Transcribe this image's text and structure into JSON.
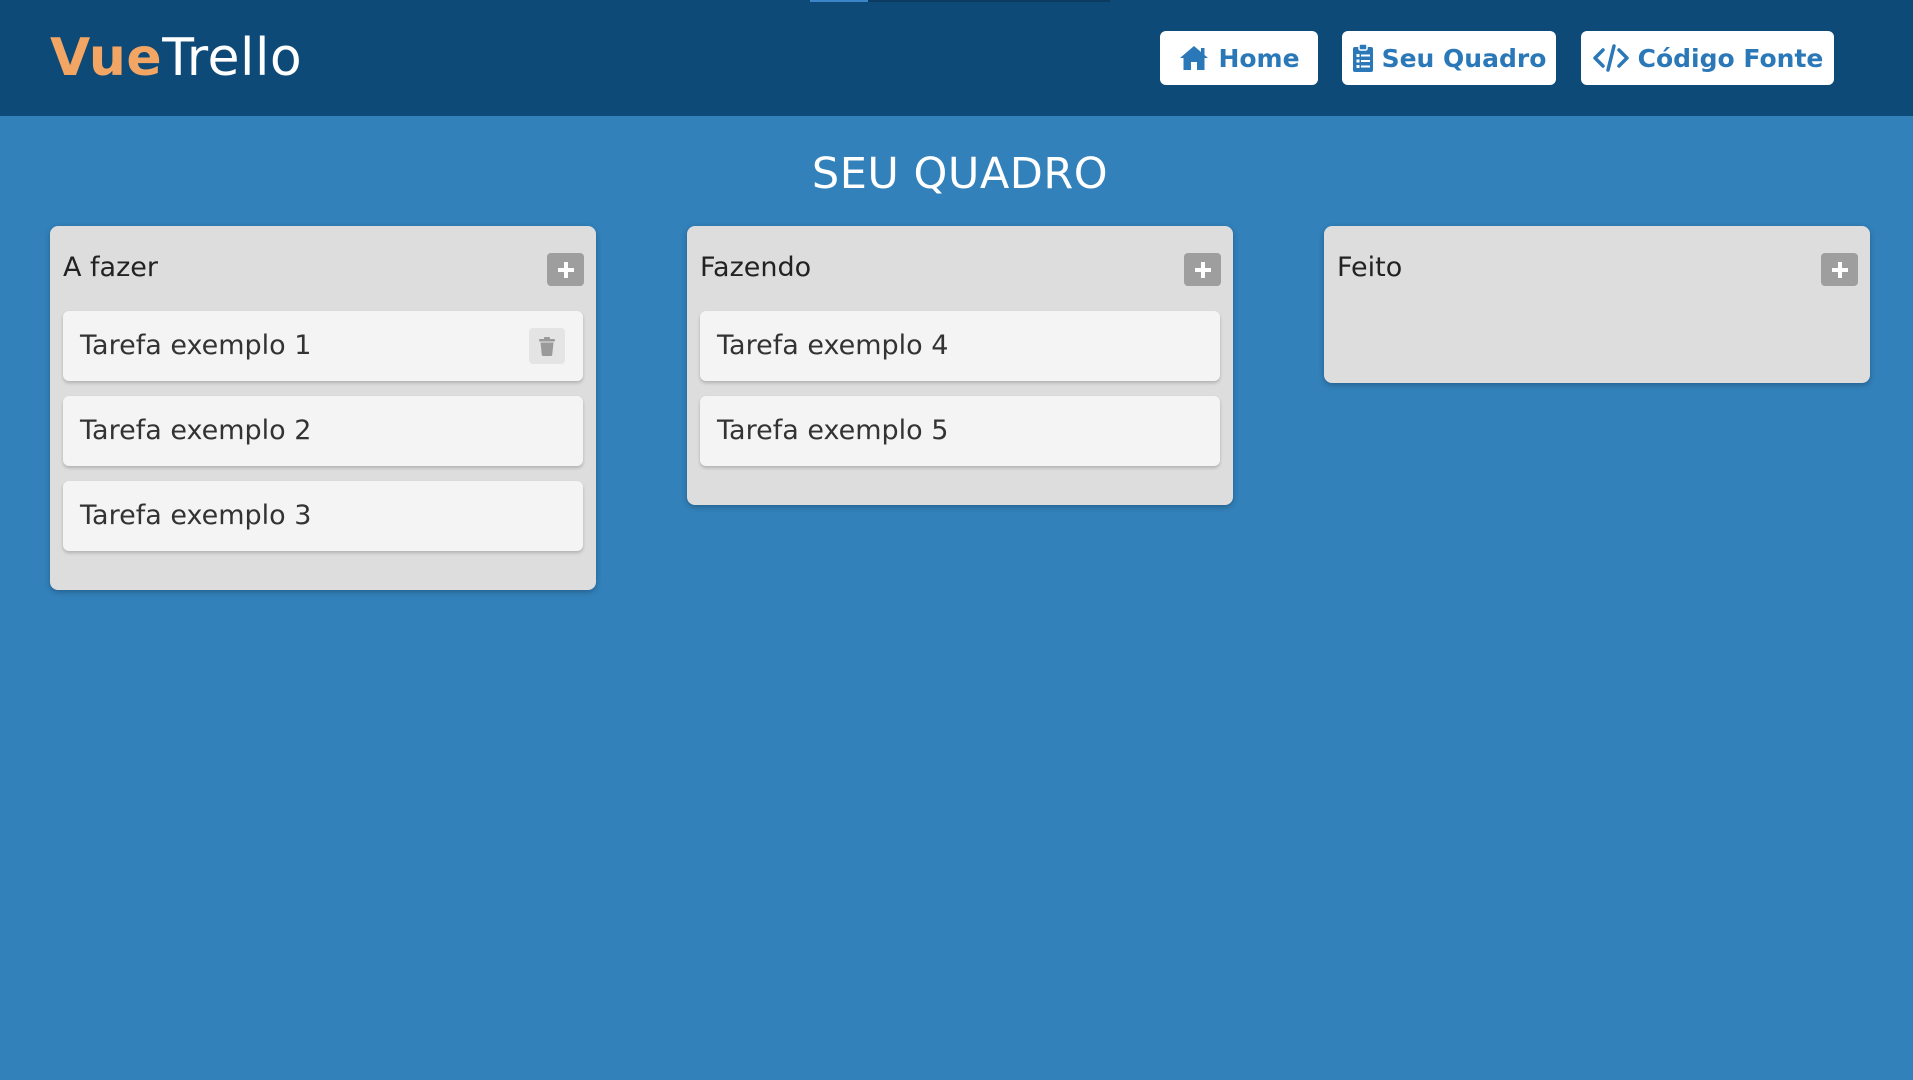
{
  "header": {
    "logo_part1": "Vue",
    "logo_part2": "Trello",
    "nav": [
      {
        "label": "Home",
        "icon": "home-icon"
      },
      {
        "label": "Seu Quadro",
        "icon": "clipboard-list-icon"
      },
      {
        "label": "Código Fonte",
        "icon": "code-icon"
      }
    ]
  },
  "main": {
    "title": "SEU QUADRO",
    "columns": [
      {
        "title": "A fazer",
        "cards": [
          "Tarefa exemplo 1",
          "Tarefa exemplo 2",
          "Tarefa exemplo 3"
        ]
      },
      {
        "title": "Fazendo",
        "cards": [
          "Tarefa exemplo 4",
          "Tarefa exemplo 5"
        ]
      },
      {
        "title": "Feito",
        "cards": []
      }
    ]
  },
  "colors": {
    "background": "#3281ba",
    "header": "#0e4a78",
    "logo_accent": "#f3a563",
    "button_text": "#2a78b8",
    "column_bg": "#dddddd",
    "card_bg": "#f4f4f5"
  }
}
